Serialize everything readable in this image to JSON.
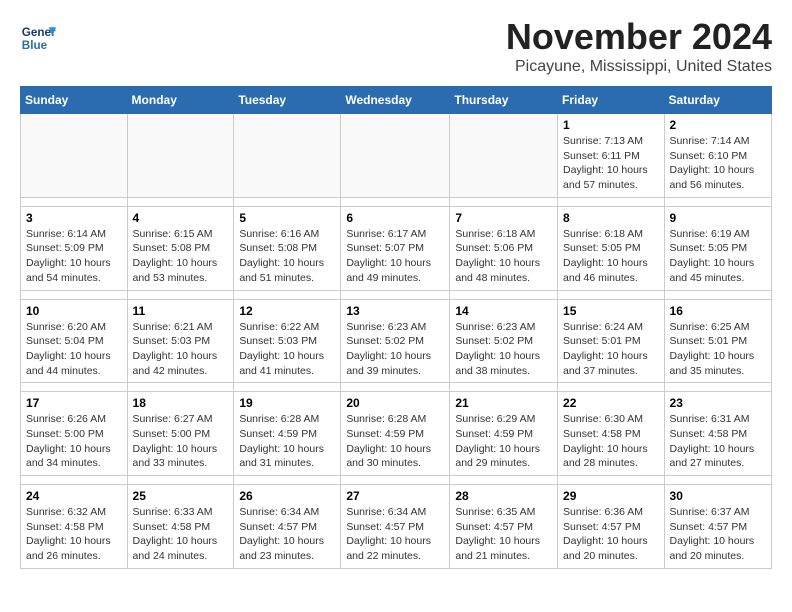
{
  "header": {
    "logo_line1": "General",
    "logo_line2": "Blue",
    "title": "November 2024",
    "subtitle": "Picayune, Mississippi, United States"
  },
  "weekdays": [
    "Sunday",
    "Monday",
    "Tuesday",
    "Wednesday",
    "Thursday",
    "Friday",
    "Saturday"
  ],
  "weeks": [
    [
      {
        "day": "",
        "info": ""
      },
      {
        "day": "",
        "info": ""
      },
      {
        "day": "",
        "info": ""
      },
      {
        "day": "",
        "info": ""
      },
      {
        "day": "",
        "info": ""
      },
      {
        "day": "1",
        "info": "Sunrise: 7:13 AM\nSunset: 6:11 PM\nDaylight: 10 hours and 57 minutes."
      },
      {
        "day": "2",
        "info": "Sunrise: 7:14 AM\nSunset: 6:10 PM\nDaylight: 10 hours and 56 minutes."
      }
    ],
    [
      {
        "day": "3",
        "info": "Sunrise: 6:14 AM\nSunset: 5:09 PM\nDaylight: 10 hours and 54 minutes."
      },
      {
        "day": "4",
        "info": "Sunrise: 6:15 AM\nSunset: 5:08 PM\nDaylight: 10 hours and 53 minutes."
      },
      {
        "day": "5",
        "info": "Sunrise: 6:16 AM\nSunset: 5:08 PM\nDaylight: 10 hours and 51 minutes."
      },
      {
        "day": "6",
        "info": "Sunrise: 6:17 AM\nSunset: 5:07 PM\nDaylight: 10 hours and 49 minutes."
      },
      {
        "day": "7",
        "info": "Sunrise: 6:18 AM\nSunset: 5:06 PM\nDaylight: 10 hours and 48 minutes."
      },
      {
        "day": "8",
        "info": "Sunrise: 6:18 AM\nSunset: 5:05 PM\nDaylight: 10 hours and 46 minutes."
      },
      {
        "day": "9",
        "info": "Sunrise: 6:19 AM\nSunset: 5:05 PM\nDaylight: 10 hours and 45 minutes."
      }
    ],
    [
      {
        "day": "10",
        "info": "Sunrise: 6:20 AM\nSunset: 5:04 PM\nDaylight: 10 hours and 44 minutes."
      },
      {
        "day": "11",
        "info": "Sunrise: 6:21 AM\nSunset: 5:03 PM\nDaylight: 10 hours and 42 minutes."
      },
      {
        "day": "12",
        "info": "Sunrise: 6:22 AM\nSunset: 5:03 PM\nDaylight: 10 hours and 41 minutes."
      },
      {
        "day": "13",
        "info": "Sunrise: 6:23 AM\nSunset: 5:02 PM\nDaylight: 10 hours and 39 minutes."
      },
      {
        "day": "14",
        "info": "Sunrise: 6:23 AM\nSunset: 5:02 PM\nDaylight: 10 hours and 38 minutes."
      },
      {
        "day": "15",
        "info": "Sunrise: 6:24 AM\nSunset: 5:01 PM\nDaylight: 10 hours and 37 minutes."
      },
      {
        "day": "16",
        "info": "Sunrise: 6:25 AM\nSunset: 5:01 PM\nDaylight: 10 hours and 35 minutes."
      }
    ],
    [
      {
        "day": "17",
        "info": "Sunrise: 6:26 AM\nSunset: 5:00 PM\nDaylight: 10 hours and 34 minutes."
      },
      {
        "day": "18",
        "info": "Sunrise: 6:27 AM\nSunset: 5:00 PM\nDaylight: 10 hours and 33 minutes."
      },
      {
        "day": "19",
        "info": "Sunrise: 6:28 AM\nSunset: 4:59 PM\nDaylight: 10 hours and 31 minutes."
      },
      {
        "day": "20",
        "info": "Sunrise: 6:28 AM\nSunset: 4:59 PM\nDaylight: 10 hours and 30 minutes."
      },
      {
        "day": "21",
        "info": "Sunrise: 6:29 AM\nSunset: 4:59 PM\nDaylight: 10 hours and 29 minutes."
      },
      {
        "day": "22",
        "info": "Sunrise: 6:30 AM\nSunset: 4:58 PM\nDaylight: 10 hours and 28 minutes."
      },
      {
        "day": "23",
        "info": "Sunrise: 6:31 AM\nSunset: 4:58 PM\nDaylight: 10 hours and 27 minutes."
      }
    ],
    [
      {
        "day": "24",
        "info": "Sunrise: 6:32 AM\nSunset: 4:58 PM\nDaylight: 10 hours and 26 minutes."
      },
      {
        "day": "25",
        "info": "Sunrise: 6:33 AM\nSunset: 4:58 PM\nDaylight: 10 hours and 24 minutes."
      },
      {
        "day": "26",
        "info": "Sunrise: 6:34 AM\nSunset: 4:57 PM\nDaylight: 10 hours and 23 minutes."
      },
      {
        "day": "27",
        "info": "Sunrise: 6:34 AM\nSunset: 4:57 PM\nDaylight: 10 hours and 22 minutes."
      },
      {
        "day": "28",
        "info": "Sunrise: 6:35 AM\nSunset: 4:57 PM\nDaylight: 10 hours and 21 minutes."
      },
      {
        "day": "29",
        "info": "Sunrise: 6:36 AM\nSunset: 4:57 PM\nDaylight: 10 hours and 20 minutes."
      },
      {
        "day": "30",
        "info": "Sunrise: 6:37 AM\nSunset: 4:57 PM\nDaylight: 10 hours and 20 minutes."
      }
    ]
  ]
}
